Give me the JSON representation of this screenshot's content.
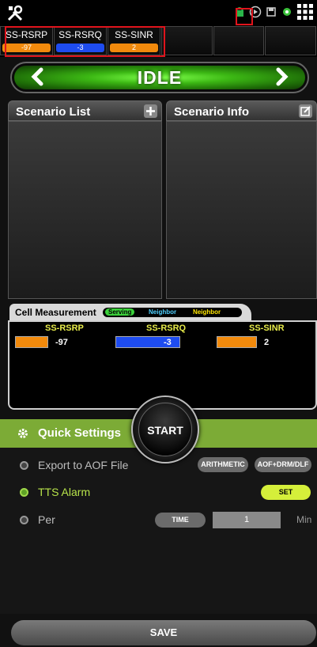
{
  "metrics": [
    {
      "label": "SS-RSRP",
      "value": "-97",
      "color": "#f28a0c"
    },
    {
      "label": "SS-RSRQ",
      "value": "-3",
      "color": "#1e4cf0"
    },
    {
      "label": "SS-SINR",
      "value": "2",
      "color": "#f28a0c"
    }
  ],
  "status": "IDLE",
  "panels": {
    "scenario_list": "Scenario List",
    "scenario_info": "Scenario Info"
  },
  "cell_measurement": {
    "title": "Cell Measurement",
    "legend": [
      "Serving",
      "Neighbor",
      "Neighbor"
    ],
    "columns": [
      {
        "label": "SS-RSRP",
        "value": "-97",
        "color": "#f28a0c"
      },
      {
        "label": "SS-RSRQ",
        "value": "-3",
        "color": "#1e4cf0"
      },
      {
        "label": "SS-SINR",
        "value": "2",
        "color": "#f28a0c"
      }
    ]
  },
  "start_label": "START",
  "quick_settings": {
    "title": "Quick Settings",
    "export_label": "Export to AOF File",
    "arithmetic_label": "ARITHMETIC",
    "aof_label": "AOF+DRM/DLF",
    "tts_label": "TTS Alarm",
    "set_label": "SET",
    "per_label": "Per",
    "time_label": "TIME",
    "per_value": "1",
    "unit_label": "Min"
  },
  "save_label": "SAVE",
  "accent_green": "#7cab36"
}
